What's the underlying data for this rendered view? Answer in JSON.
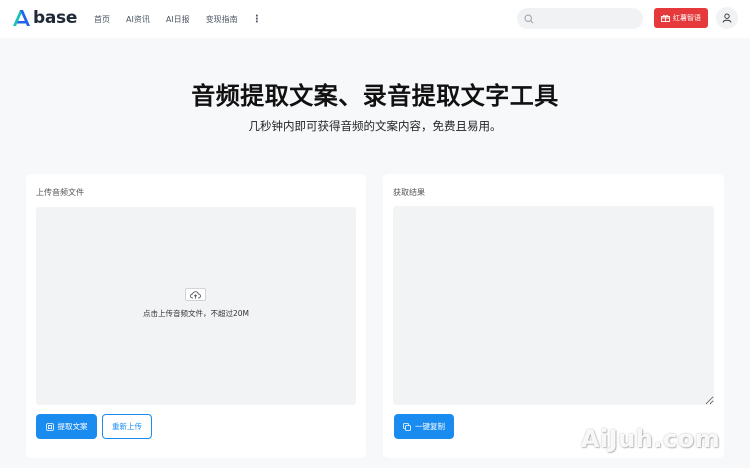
{
  "header": {
    "logo_text": "base",
    "nav": [
      "首页",
      "AI资讯",
      "AI日报",
      "变现指南"
    ],
    "more_icon": "more-vertical-icon",
    "search": {
      "placeholder": "",
      "value": ""
    },
    "hongshu_label": "红薯智语",
    "user_icon": "user-icon"
  },
  "hero": {
    "title": "音频提取文案、录音提取文字工具",
    "subtitle": "几秒钟内即可获得音频的文案内容，免费且易用。"
  },
  "upload_card": {
    "label": "上传音频文件",
    "hint": "点击上传音频文件，不超过20M",
    "extract_button": "提取文案",
    "reupload_button": "重新上传"
  },
  "result_card": {
    "label": "获取结果",
    "result_text": "",
    "copy_button": "一键复制"
  },
  "watermark": "AiJuh.com",
  "colors": {
    "primary": "#1a8cf0",
    "hongshu": "#e5393b",
    "logo_accent": "#19c2b8"
  }
}
